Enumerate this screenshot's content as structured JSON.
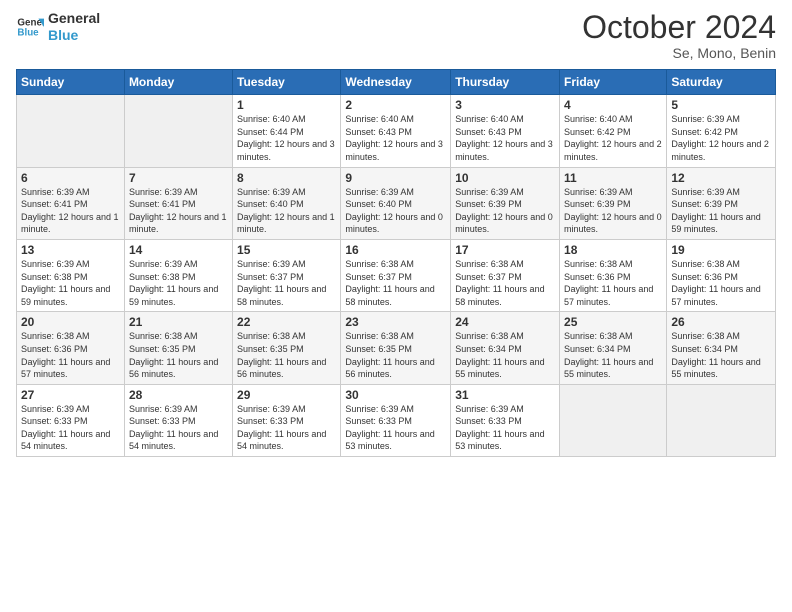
{
  "header": {
    "logo_line1": "General",
    "logo_line2": "Blue",
    "month": "October 2024",
    "location": "Se, Mono, Benin"
  },
  "weekdays": [
    "Sunday",
    "Monday",
    "Tuesday",
    "Wednesday",
    "Thursday",
    "Friday",
    "Saturday"
  ],
  "weeks": [
    [
      {
        "day": "",
        "empty": true
      },
      {
        "day": "",
        "empty": true
      },
      {
        "day": "1",
        "sunrise": "6:40 AM",
        "sunset": "6:44 PM",
        "daylight": "12 hours and 3 minutes."
      },
      {
        "day": "2",
        "sunrise": "6:40 AM",
        "sunset": "6:43 PM",
        "daylight": "12 hours and 3 minutes."
      },
      {
        "day": "3",
        "sunrise": "6:40 AM",
        "sunset": "6:43 PM",
        "daylight": "12 hours and 3 minutes."
      },
      {
        "day": "4",
        "sunrise": "6:40 AM",
        "sunset": "6:42 PM",
        "daylight": "12 hours and 2 minutes."
      },
      {
        "day": "5",
        "sunrise": "6:39 AM",
        "sunset": "6:42 PM",
        "daylight": "12 hours and 2 minutes."
      }
    ],
    [
      {
        "day": "6",
        "sunrise": "6:39 AM",
        "sunset": "6:41 PM",
        "daylight": "12 hours and 1 minute."
      },
      {
        "day": "7",
        "sunrise": "6:39 AM",
        "sunset": "6:41 PM",
        "daylight": "12 hours and 1 minute."
      },
      {
        "day": "8",
        "sunrise": "6:39 AM",
        "sunset": "6:40 PM",
        "daylight": "12 hours and 1 minute."
      },
      {
        "day": "9",
        "sunrise": "6:39 AM",
        "sunset": "6:40 PM",
        "daylight": "12 hours and 0 minutes."
      },
      {
        "day": "10",
        "sunrise": "6:39 AM",
        "sunset": "6:39 PM",
        "daylight": "12 hours and 0 minutes."
      },
      {
        "day": "11",
        "sunrise": "6:39 AM",
        "sunset": "6:39 PM",
        "daylight": "12 hours and 0 minutes."
      },
      {
        "day": "12",
        "sunrise": "6:39 AM",
        "sunset": "6:39 PM",
        "daylight": "11 hours and 59 minutes."
      }
    ],
    [
      {
        "day": "13",
        "sunrise": "6:39 AM",
        "sunset": "6:38 PM",
        "daylight": "11 hours and 59 minutes."
      },
      {
        "day": "14",
        "sunrise": "6:39 AM",
        "sunset": "6:38 PM",
        "daylight": "11 hours and 59 minutes."
      },
      {
        "day": "15",
        "sunrise": "6:39 AM",
        "sunset": "6:37 PM",
        "daylight": "11 hours and 58 minutes."
      },
      {
        "day": "16",
        "sunrise": "6:38 AM",
        "sunset": "6:37 PM",
        "daylight": "11 hours and 58 minutes."
      },
      {
        "day": "17",
        "sunrise": "6:38 AM",
        "sunset": "6:37 PM",
        "daylight": "11 hours and 58 minutes."
      },
      {
        "day": "18",
        "sunrise": "6:38 AM",
        "sunset": "6:36 PM",
        "daylight": "11 hours and 57 minutes."
      },
      {
        "day": "19",
        "sunrise": "6:38 AM",
        "sunset": "6:36 PM",
        "daylight": "11 hours and 57 minutes."
      }
    ],
    [
      {
        "day": "20",
        "sunrise": "6:38 AM",
        "sunset": "6:36 PM",
        "daylight": "11 hours and 57 minutes."
      },
      {
        "day": "21",
        "sunrise": "6:38 AM",
        "sunset": "6:35 PM",
        "daylight": "11 hours and 56 minutes."
      },
      {
        "day": "22",
        "sunrise": "6:38 AM",
        "sunset": "6:35 PM",
        "daylight": "11 hours and 56 minutes."
      },
      {
        "day": "23",
        "sunrise": "6:38 AM",
        "sunset": "6:35 PM",
        "daylight": "11 hours and 56 minutes."
      },
      {
        "day": "24",
        "sunrise": "6:38 AM",
        "sunset": "6:34 PM",
        "daylight": "11 hours and 55 minutes."
      },
      {
        "day": "25",
        "sunrise": "6:38 AM",
        "sunset": "6:34 PM",
        "daylight": "11 hours and 55 minutes."
      },
      {
        "day": "26",
        "sunrise": "6:38 AM",
        "sunset": "6:34 PM",
        "daylight": "11 hours and 55 minutes."
      }
    ],
    [
      {
        "day": "27",
        "sunrise": "6:39 AM",
        "sunset": "6:33 PM",
        "daylight": "11 hours and 54 minutes."
      },
      {
        "day": "28",
        "sunrise": "6:39 AM",
        "sunset": "6:33 PM",
        "daylight": "11 hours and 54 minutes."
      },
      {
        "day": "29",
        "sunrise": "6:39 AM",
        "sunset": "6:33 PM",
        "daylight": "11 hours and 54 minutes."
      },
      {
        "day": "30",
        "sunrise": "6:39 AM",
        "sunset": "6:33 PM",
        "daylight": "11 hours and 53 minutes."
      },
      {
        "day": "31",
        "sunrise": "6:39 AM",
        "sunset": "6:33 PM",
        "daylight": "11 hours and 53 minutes."
      },
      {
        "day": "",
        "empty": true
      },
      {
        "day": "",
        "empty": true
      }
    ]
  ]
}
